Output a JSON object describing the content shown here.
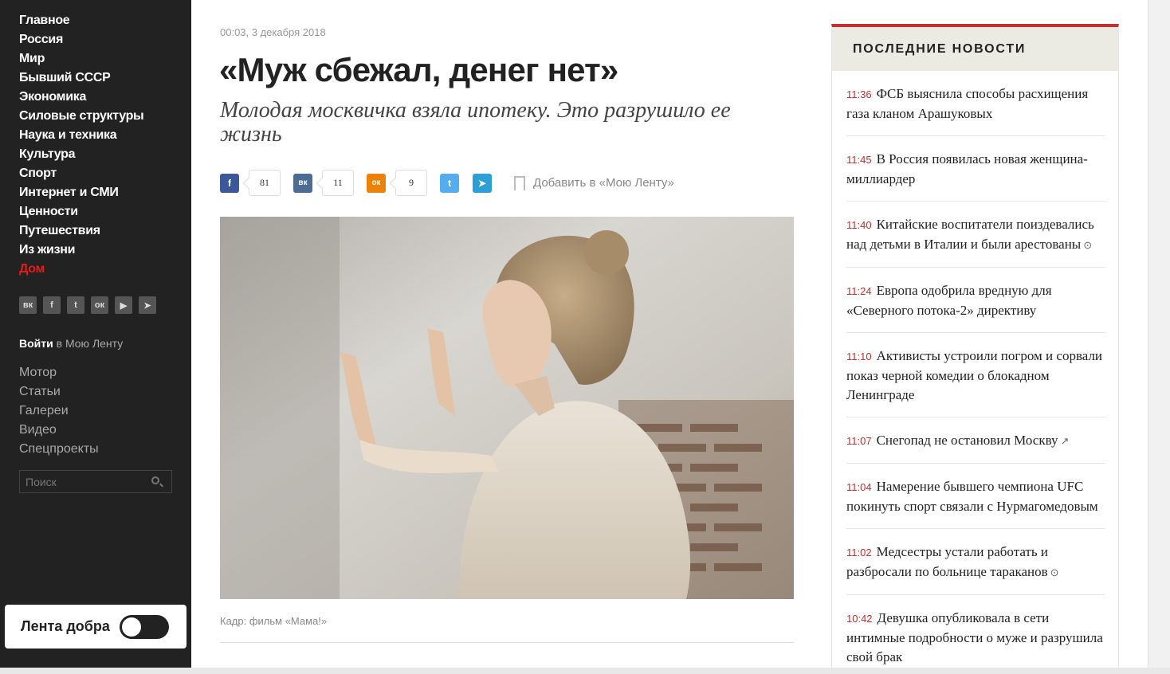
{
  "sidebar": {
    "nav": [
      "Главное",
      "Россия",
      "Мир",
      "Бывший СССР",
      "Экономика",
      "Силовые структуры",
      "Наука и техника",
      "Культура",
      "Спорт",
      "Интернет и СМИ",
      "Ценности",
      "Путешествия",
      "Из жизни",
      "Дом"
    ],
    "active_item": "Дом",
    "socials": [
      {
        "name": "vk-icon",
        "glyph": "вк"
      },
      {
        "name": "facebook-icon",
        "glyph": "f"
      },
      {
        "name": "twitter-icon",
        "glyph": "t"
      },
      {
        "name": "odnoklassniki-icon",
        "glyph": "ок"
      },
      {
        "name": "youtube-icon",
        "glyph": "▶"
      },
      {
        "name": "telegram-icon",
        "glyph": "➤"
      }
    ],
    "login_bold": "Войти",
    "login_rest": " в Мою Ленту",
    "secondary": [
      "Мотор",
      "Статьи",
      "Галереи",
      "Видео",
      "Спецпроекты"
    ],
    "search_placeholder": "Поиск",
    "kind_feed_label": "Лента добра"
  },
  "article": {
    "date": "00:03, 3 декабря 2018",
    "title": "«Муж сбежал, денег нет»",
    "subtitle": "Молодая москвичка взяла ипотеку. Это разрушило ее жизнь",
    "share": {
      "facebook": {
        "glyph": "f",
        "count": "81",
        "color": "#3b5998"
      },
      "vk": {
        "glyph": "вк",
        "count": "11",
        "color": "#4c6c91"
      },
      "ok": {
        "glyph": "ок",
        "count": "9",
        "color": "#ee8208"
      },
      "twitter": {
        "glyph": "t",
        "color": "#55acee"
      },
      "telegram": {
        "glyph": "➤",
        "color": "#2b9fd6"
      }
    },
    "bookmark_label": "Добавить в «Мою Ленту»",
    "caption": "Кадр: фильм «Мама!»"
  },
  "latest": {
    "header": "ПОСЛЕДНИЕ НОВОСТИ",
    "items": [
      {
        "time": "11:36",
        "text": "ФСБ выяснила способы расхищения газа кланом Арашуковых",
        "icon": ""
      },
      {
        "time": "11:45",
        "text": "В Россия появилась новая женщина-миллиардер",
        "icon": ""
      },
      {
        "time": "11:40",
        "text": "Китайские воспитатели поиздевались над детьми в Италии и были арестованы",
        "icon": "video-icon"
      },
      {
        "time": "11:24",
        "text": "Европа одобрила вредную для «Северного потока-2» директиву",
        "icon": ""
      },
      {
        "time": "11:10",
        "text": "Активисты устроили погром и сорвали показ черной комедии о блокадном Ленинграде",
        "icon": ""
      },
      {
        "time": "11:07",
        "text": "Снегопад не остановил Москву",
        "icon": "external-link-icon"
      },
      {
        "time": "11:04",
        "text": "Намерение бывшего чемпиона UFC покинуть спорт связали с Нурмагомедовым",
        "icon": ""
      },
      {
        "time": "11:02",
        "text": "Медсестры устали работать и разбросали по больнице тараканов",
        "icon": "video-icon"
      },
      {
        "time": "10:42",
        "text": "Девушка опубликовала в сети интимные подробности о муже и разрушила свой брак",
        "icon": ""
      }
    ]
  }
}
